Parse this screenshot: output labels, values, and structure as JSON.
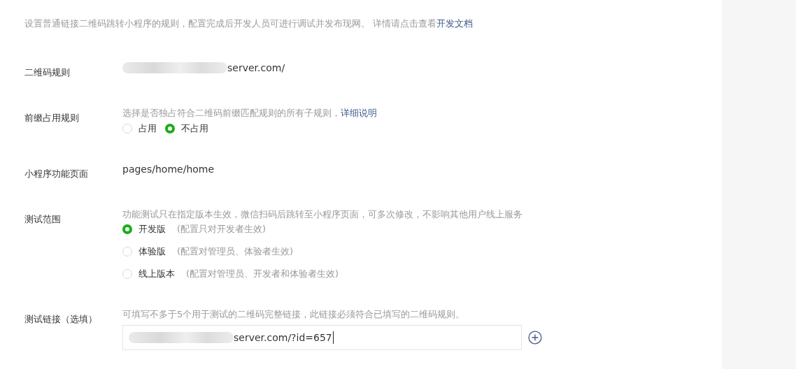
{
  "intro": {
    "text": "设置普通链接二维码跳转小程序的规则，配置完成后开发人员可进行调试并发布现网。 详情请点击查看",
    "link": "开发文档"
  },
  "fields": [
    {
      "kind": "value",
      "label": "二维码规则",
      "value": "server.com/",
      "redacted": true
    },
    {
      "kind": "radio",
      "label": "前缀占用规则",
      "description": "选择是否独占符合二维码前缀匹配规则的所有子规则，",
      "link": "详细说明",
      "stacked": false,
      "options": [
        {
          "label": "占用",
          "selected": false
        },
        {
          "label": "不占用",
          "selected": true
        }
      ]
    },
    {
      "kind": "value",
      "label": "小程序功能页面",
      "value": "pages/home/home",
      "redacted": false
    },
    {
      "kind": "radio",
      "label": "测试范围",
      "description": "功能测试只在指定版本生效，微信扫码后跳转至小程序页面，可多次修改，不影响其他用户线上服务",
      "stacked": true,
      "options": [
        {
          "label": "开发版",
          "note": "(配置只对开发者生效)",
          "selected": true
        },
        {
          "label": "体验版",
          "note": "(配置对管理员、体验者生效)",
          "selected": false
        },
        {
          "label": "线上版本",
          "note": "(配置对管理员、开发者和体验者生效)",
          "selected": false
        }
      ]
    },
    {
      "kind": "input",
      "label": "测试链接（选填）",
      "description": "可填写不多于5个用于测试的二维码完整链接，此链接必须符合已填写的二维码规则。",
      "value": "server.com/?id=657",
      "redacted": true
    }
  ]
}
